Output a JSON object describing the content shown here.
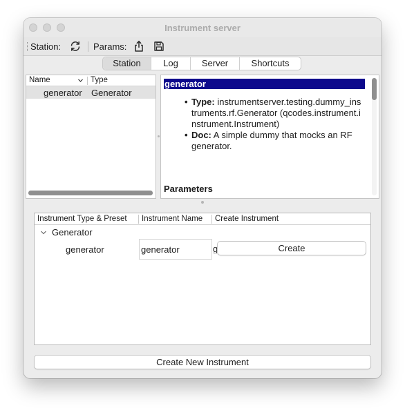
{
  "window": {
    "title": "Instrument server"
  },
  "toolbar": {
    "station_label": "Station:",
    "params_label": "Params:",
    "refresh_icon": "refresh-icon",
    "export_icon": "share-export-icon",
    "save_icon": "floppy-save-icon"
  },
  "tabs": [
    {
      "label": "Station",
      "active": true
    },
    {
      "label": "Log",
      "active": false
    },
    {
      "label": "Server",
      "active": false
    },
    {
      "label": "Shortcuts",
      "active": false
    }
  ],
  "station_list": {
    "columns": [
      "Name",
      "Type"
    ],
    "rows": [
      {
        "name": "generator",
        "type": "Generator"
      }
    ]
  },
  "doc_panel": {
    "heading": "generator",
    "items": [
      {
        "label": "Type:",
        "text": "instrumentserver.testing.dummy_instruments.rf.Generator (qcodes.instrument.instrument.Instrument)"
      },
      {
        "label": "Doc:",
        "text": "A simple dummy that mocks an RF generator."
      }
    ],
    "parameters_heading": "Parameters"
  },
  "create_panel": {
    "columns": [
      "Instrument Type & Preset",
      "Instrument Name",
      "Create Instrument"
    ],
    "group": "Generator",
    "preset": "generator",
    "name_value": "generator",
    "overflow_char": "g",
    "create_label": "Create"
  },
  "footer": {
    "new_instrument_label": "Create New Instrument"
  },
  "colors": {
    "heading_bg": "#0d0a8c",
    "window_bg": "#ececec",
    "title_text": "#ababab"
  }
}
